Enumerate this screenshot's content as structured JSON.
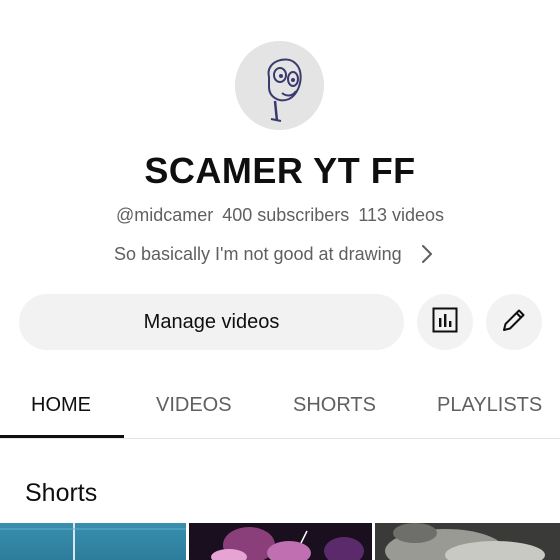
{
  "channel": {
    "name": "SCAMER YT FF",
    "handle": "@midcamer",
    "subscribers": "400 subscribers",
    "videos": "113 videos",
    "description": "So basically I'm not good at drawing"
  },
  "actions": {
    "manage_label": "Manage videos"
  },
  "tabs": [
    {
      "label": "HOME",
      "active": true
    },
    {
      "label": "VIDEOS",
      "active": false
    },
    {
      "label": "SHORTS",
      "active": false
    },
    {
      "label": "PLAYLISTS",
      "active": false
    }
  ],
  "sections": {
    "shorts_title": "Shorts"
  },
  "colors": {
    "text_primary": "#0f0f0f",
    "text_secondary": "#606060",
    "button_bg": "#f2f2f2",
    "divider": "#e5e5e5"
  },
  "icons": {
    "avatar": "hand-drawn-face",
    "description_more": "chevron-right-icon",
    "analytics": "bar-chart-icon",
    "edit": "pencil-icon"
  }
}
